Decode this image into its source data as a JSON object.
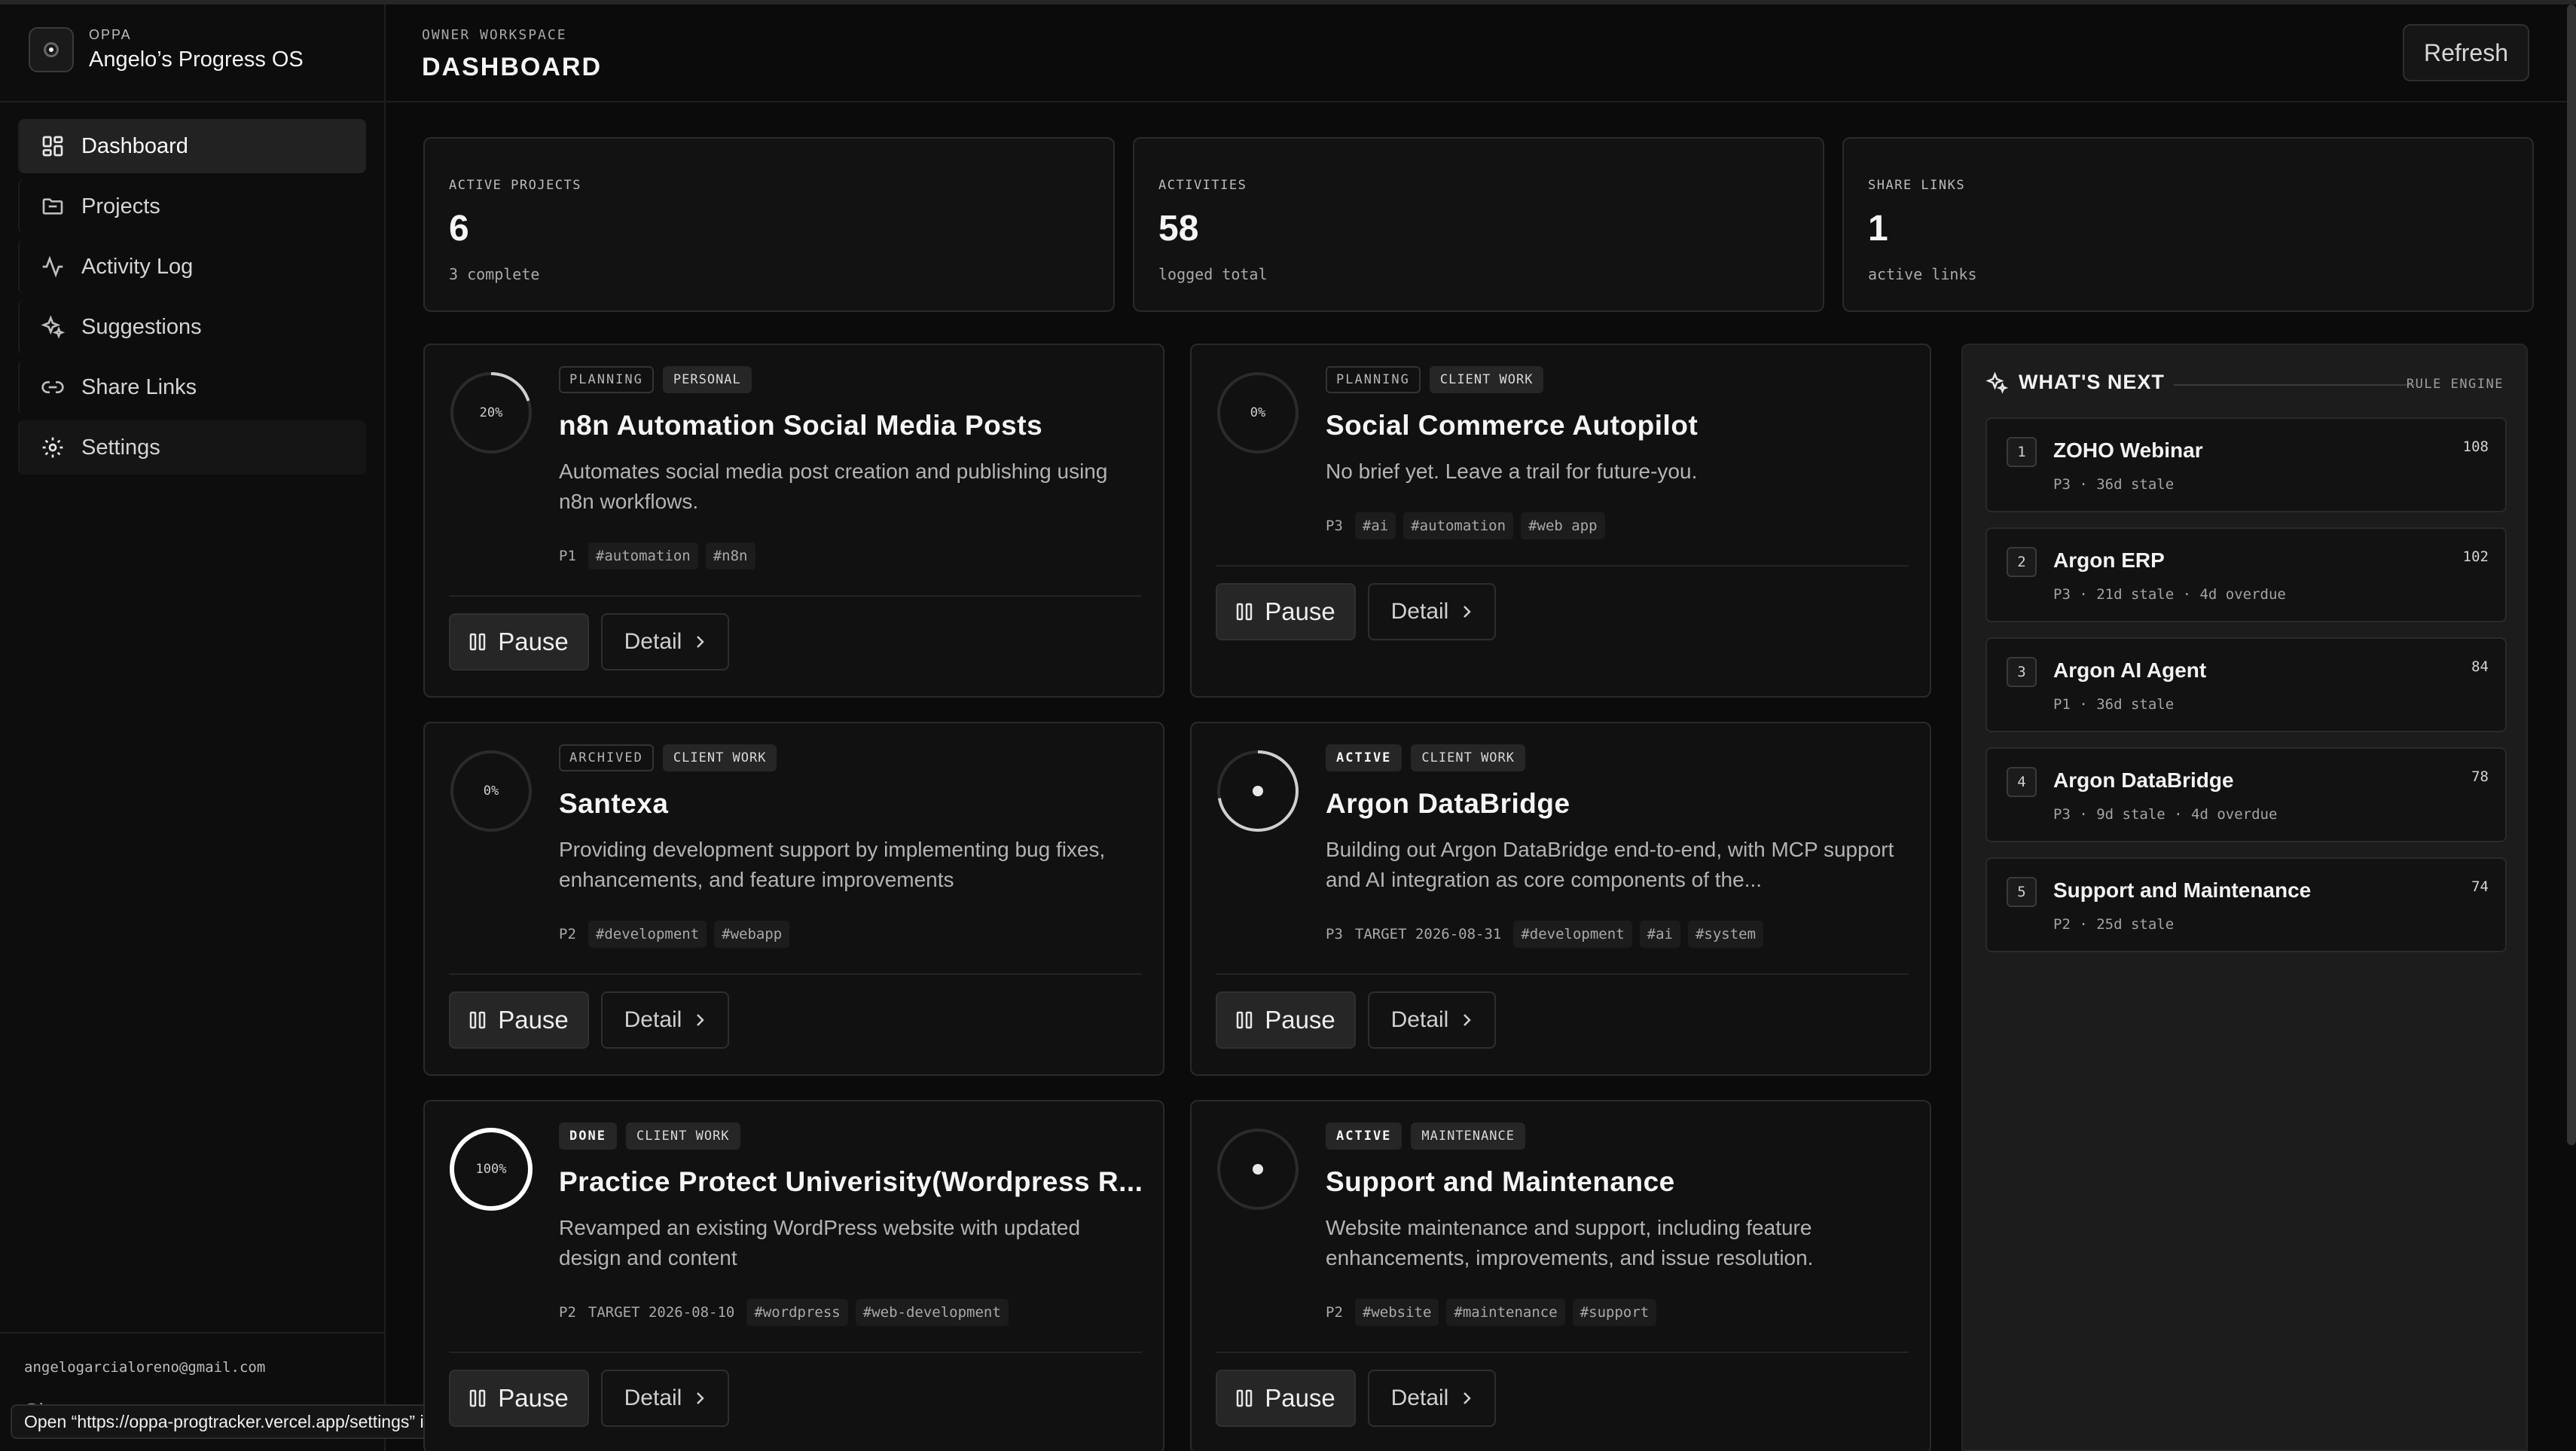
{
  "brand": {
    "kicker": "OPPA",
    "name": "Angelo’s Progress OS"
  },
  "nav": [
    {
      "label": "Dashboard",
      "icon": "grid-icon"
    },
    {
      "label": "Projects",
      "icon": "folder-icon"
    },
    {
      "label": "Activity Log",
      "icon": "activity-icon"
    },
    {
      "label": "Suggestions",
      "icon": "sparkles-icon"
    },
    {
      "label": "Share Links",
      "icon": "link-icon"
    },
    {
      "label": "Settings",
      "icon": "gear-icon"
    }
  ],
  "user": {
    "email": "angelogarcialoreno@gmail.com",
    "signout": "Sign out"
  },
  "status_tooltip": "Open “https://oppa-progtracker.vercel.app/settings” in a new tab",
  "header": {
    "kicker": "OWNER WORKSPACE",
    "title": "DASHBOARD",
    "refresh": "Refresh"
  },
  "stats": [
    {
      "label": "ACTIVE PROJECTS",
      "value": "6",
      "sub": "3 complete"
    },
    {
      "label": "ACTIVITIES",
      "value": "58",
      "sub": "logged total"
    },
    {
      "label": "SHARE LINKS",
      "value": "1",
      "sub": "active links"
    }
  ],
  "buttons": {
    "pause": "Pause",
    "detail": "Detail"
  },
  "projects": [
    {
      "progress_label": "20%",
      "progress": 0.2,
      "status": "PLANNING",
      "category": "PERSONAL",
      "title": "n8n Automation Social Media Posts",
      "desc": "Automates social media post creation and publishing using n8n workflows.",
      "priority": "P1",
      "target": "",
      "tags": [
        "#automation",
        "#n8n"
      ]
    },
    {
      "progress_label": "0%",
      "progress": 0,
      "status": "PLANNING",
      "category": "CLIENT WORK",
      "title": "Social Commerce Autopilot",
      "desc": "No brief yet. Leave a trail for future-you.",
      "priority": "P3",
      "target": "",
      "tags": [
        "#ai",
        "#automation",
        "#web app"
      ]
    },
    {
      "progress_label": "0%",
      "progress": 0,
      "status": "ARCHIVED",
      "category": "CLIENT WORK",
      "title": "Santexa",
      "desc": "Providing development support by implementing bug fixes, enhancements, and feature improvements",
      "priority": "P2",
      "target": "",
      "tags": [
        "#development",
        "#webapp"
      ]
    },
    {
      "progress_label": "",
      "progress": 0.72,
      "status": "ACTIVE",
      "category": "CLIENT WORK",
      "title": "Argon DataBridge",
      "desc": "Building out Argon DataBridge end-to-end, with MCP support and AI integration as core components of the...",
      "priority": "P3",
      "target": "TARGET 2026-08-31",
      "tags": [
        "#development",
        "#ai",
        "#system"
      ]
    },
    {
      "progress_label": "100%",
      "progress": 1,
      "status": "DONE",
      "category": "CLIENT WORK",
      "title": "Practice Protect Univerisity(Wordpress R...",
      "desc": "Revamped an existing WordPress website with updated design and content",
      "priority": "P2",
      "target": "TARGET 2026-08-10",
      "tags": [
        "#wordpress",
        "#web-development"
      ]
    },
    {
      "progress_label": "",
      "progress": 0,
      "status": "ACTIVE",
      "category": "MAINTENANCE",
      "title": "Support and Maintenance",
      "desc": "Website maintenance and support, including feature enhancements, improvements, and issue resolution.",
      "priority": "P2",
      "target": "",
      "tags": [
        "#website",
        "#maintenance",
        "#support"
      ]
    }
  ],
  "whats_next": {
    "title": "WHAT'S NEXT",
    "engine": "RULE ENGINE",
    "items": [
      {
        "rank": "1",
        "title": "ZOHO Webinar",
        "meta": "P3 · 36d stale",
        "score": "108"
      },
      {
        "rank": "2",
        "title": "Argon ERP",
        "meta": "P3 · 21d stale · 4d overdue",
        "score": "102"
      },
      {
        "rank": "3",
        "title": "Argon AI Agent",
        "meta": "P1 · 36d stale",
        "score": "84"
      },
      {
        "rank": "4",
        "title": "Argon DataBridge",
        "meta": "P3 · 9d stale · 4d overdue",
        "score": "78"
      },
      {
        "rank": "5",
        "title": "Support and Maintenance",
        "meta": "P2 · 25d stale",
        "score": "74"
      }
    ]
  }
}
